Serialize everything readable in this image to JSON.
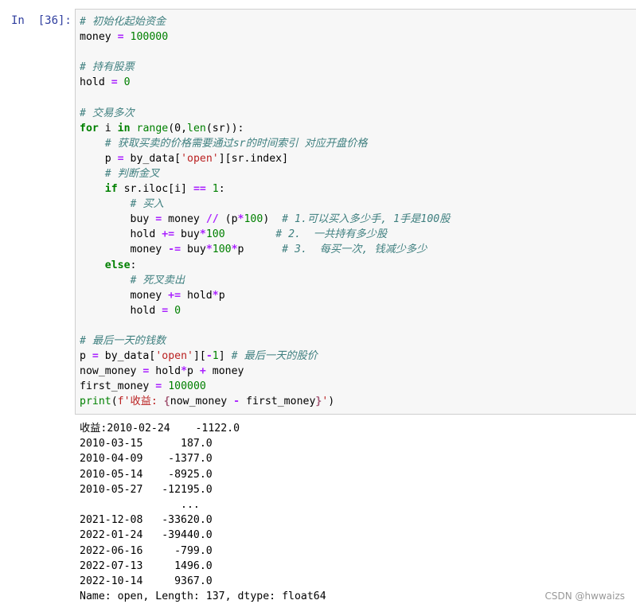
{
  "cell": {
    "prompt": "In  [36]:",
    "code_lines": [
      [
        {
          "t": "# 初始化起始资金",
          "c": "comment"
        }
      ],
      [
        {
          "t": "money ",
          "c": "plain"
        },
        {
          "t": "=",
          "c": "op"
        },
        {
          "t": " ",
          "c": "plain"
        },
        {
          "t": "100000",
          "c": "num"
        }
      ],
      [],
      [
        {
          "t": "# 持有股票",
          "c": "comment"
        }
      ],
      [
        {
          "t": "hold ",
          "c": "plain"
        },
        {
          "t": "=",
          "c": "op"
        },
        {
          "t": " ",
          "c": "plain"
        },
        {
          "t": "0",
          "c": "num"
        }
      ],
      [],
      [
        {
          "t": "# 交易多次",
          "c": "comment"
        }
      ],
      [
        {
          "t": "for",
          "c": "kw"
        },
        {
          "t": " i ",
          "c": "plain"
        },
        {
          "t": "in",
          "c": "kw"
        },
        {
          "t": " ",
          "c": "plain"
        },
        {
          "t": "range",
          "c": "builtin"
        },
        {
          "t": "(0,",
          "c": "plain"
        },
        {
          "t": "len",
          "c": "builtin"
        },
        {
          "t": "(sr)):",
          "c": "plain"
        }
      ],
      [
        {
          "t": "    ",
          "c": "plain"
        },
        {
          "t": "# 获取买卖的价格需要通过sr的时间索引 对应开盘价格",
          "c": "comment"
        }
      ],
      [
        {
          "t": "    p ",
          "c": "plain"
        },
        {
          "t": "=",
          "c": "op"
        },
        {
          "t": " by_data[",
          "c": "plain"
        },
        {
          "t": "'open'",
          "c": "str"
        },
        {
          "t": "][sr.index]",
          "c": "plain"
        }
      ],
      [
        {
          "t": "    ",
          "c": "plain"
        },
        {
          "t": "# 判断金叉",
          "c": "comment"
        }
      ],
      [
        {
          "t": "    ",
          "c": "plain"
        },
        {
          "t": "if",
          "c": "kw"
        },
        {
          "t": " sr.iloc[i] ",
          "c": "plain"
        },
        {
          "t": "==",
          "c": "op"
        },
        {
          "t": " ",
          "c": "plain"
        },
        {
          "t": "1",
          "c": "num"
        },
        {
          "t": ":",
          "c": "plain"
        }
      ],
      [
        {
          "t": "        ",
          "c": "plain"
        },
        {
          "t": "# 买入",
          "c": "comment"
        }
      ],
      [
        {
          "t": "        buy ",
          "c": "plain"
        },
        {
          "t": "=",
          "c": "op"
        },
        {
          "t": " money ",
          "c": "plain"
        },
        {
          "t": "//",
          "c": "op"
        },
        {
          "t": " (p",
          "c": "plain"
        },
        {
          "t": "*",
          "c": "op"
        },
        {
          "t": "100",
          "c": "num"
        },
        {
          "t": ")  ",
          "c": "plain"
        },
        {
          "t": "# 1.可以买入多少手, 1手是100股",
          "c": "comment"
        }
      ],
      [
        {
          "t": "        hold ",
          "c": "plain"
        },
        {
          "t": "+=",
          "c": "op"
        },
        {
          "t": " buy",
          "c": "plain"
        },
        {
          "t": "*",
          "c": "op"
        },
        {
          "t": "100",
          "c": "num"
        },
        {
          "t": "        ",
          "c": "plain"
        },
        {
          "t": "# 2.  一共持有多少股",
          "c": "comment"
        }
      ],
      [
        {
          "t": "        money ",
          "c": "plain"
        },
        {
          "t": "-=",
          "c": "op"
        },
        {
          "t": " buy",
          "c": "plain"
        },
        {
          "t": "*",
          "c": "op"
        },
        {
          "t": "100",
          "c": "num"
        },
        {
          "t": "*",
          "c": "op"
        },
        {
          "t": "p      ",
          "c": "plain"
        },
        {
          "t": "# 3.  每买一次, 钱减少多少",
          "c": "comment"
        }
      ],
      [
        {
          "t": "    ",
          "c": "plain"
        },
        {
          "t": "else",
          "c": "kw"
        },
        {
          "t": ":",
          "c": "plain"
        }
      ],
      [
        {
          "t": "        ",
          "c": "plain"
        },
        {
          "t": "# 死叉卖出",
          "c": "comment"
        }
      ],
      [
        {
          "t": "        money ",
          "c": "plain"
        },
        {
          "t": "+=",
          "c": "op"
        },
        {
          "t": " hold",
          "c": "plain"
        },
        {
          "t": "*",
          "c": "op"
        },
        {
          "t": "p",
          "c": "plain"
        }
      ],
      [
        {
          "t": "        hold ",
          "c": "plain"
        },
        {
          "t": "=",
          "c": "op"
        },
        {
          "t": " ",
          "c": "plain"
        },
        {
          "t": "0",
          "c": "num"
        }
      ],
      [],
      [
        {
          "t": "# 最后一天的钱数",
          "c": "comment"
        }
      ],
      [
        {
          "t": "p ",
          "c": "plain"
        },
        {
          "t": "=",
          "c": "op"
        },
        {
          "t": " by_data[",
          "c": "plain"
        },
        {
          "t": "'open'",
          "c": "str"
        },
        {
          "t": "][",
          "c": "plain"
        },
        {
          "t": "-",
          "c": "op"
        },
        {
          "t": "1",
          "c": "num"
        },
        {
          "t": "] ",
          "c": "plain"
        },
        {
          "t": "# 最后一天的股价",
          "c": "comment"
        }
      ],
      [
        {
          "t": "now_money ",
          "c": "plain"
        },
        {
          "t": "=",
          "c": "op"
        },
        {
          "t": " hold",
          "c": "plain"
        },
        {
          "t": "*",
          "c": "op"
        },
        {
          "t": "p ",
          "c": "plain"
        },
        {
          "t": "+",
          "c": "op"
        },
        {
          "t": " money",
          "c": "plain"
        }
      ],
      [
        {
          "t": "first_money ",
          "c": "plain"
        },
        {
          "t": "=",
          "c": "op"
        },
        {
          "t": " ",
          "c": "plain"
        },
        {
          "t": "100000",
          "c": "num"
        }
      ],
      [
        {
          "t": "print",
          "c": "builtin"
        },
        {
          "t": "(",
          "c": "plain"
        },
        {
          "t": "f'收益: ",
          "c": "str"
        },
        {
          "t": "{",
          "c": "interp"
        },
        {
          "t": "now_money ",
          "c": "plain"
        },
        {
          "t": "-",
          "c": "op"
        },
        {
          "t": " first_money",
          "c": "plain"
        },
        {
          "t": "}",
          "c": "interp"
        },
        {
          "t": "'",
          "c": "str"
        },
        {
          "t": ")",
          "c": "plain"
        }
      ]
    ]
  },
  "output": {
    "lines": [
      "收益:2010-02-24    -1122.0",
      "2010-03-15      187.0",
      "2010-04-09    -1377.0",
      "2010-05-14    -8925.0",
      "2010-05-27   -12195.0",
      "                ...",
      "2021-12-08   -33620.0",
      "2022-01-24   -39440.0",
      "2022-06-16     -799.0",
      "2022-07-13     1496.0",
      "2022-10-14     9367.0",
      "Name: open, Length: 137, dtype: float64"
    ]
  },
  "watermark": "CSDN @hwwaizs"
}
